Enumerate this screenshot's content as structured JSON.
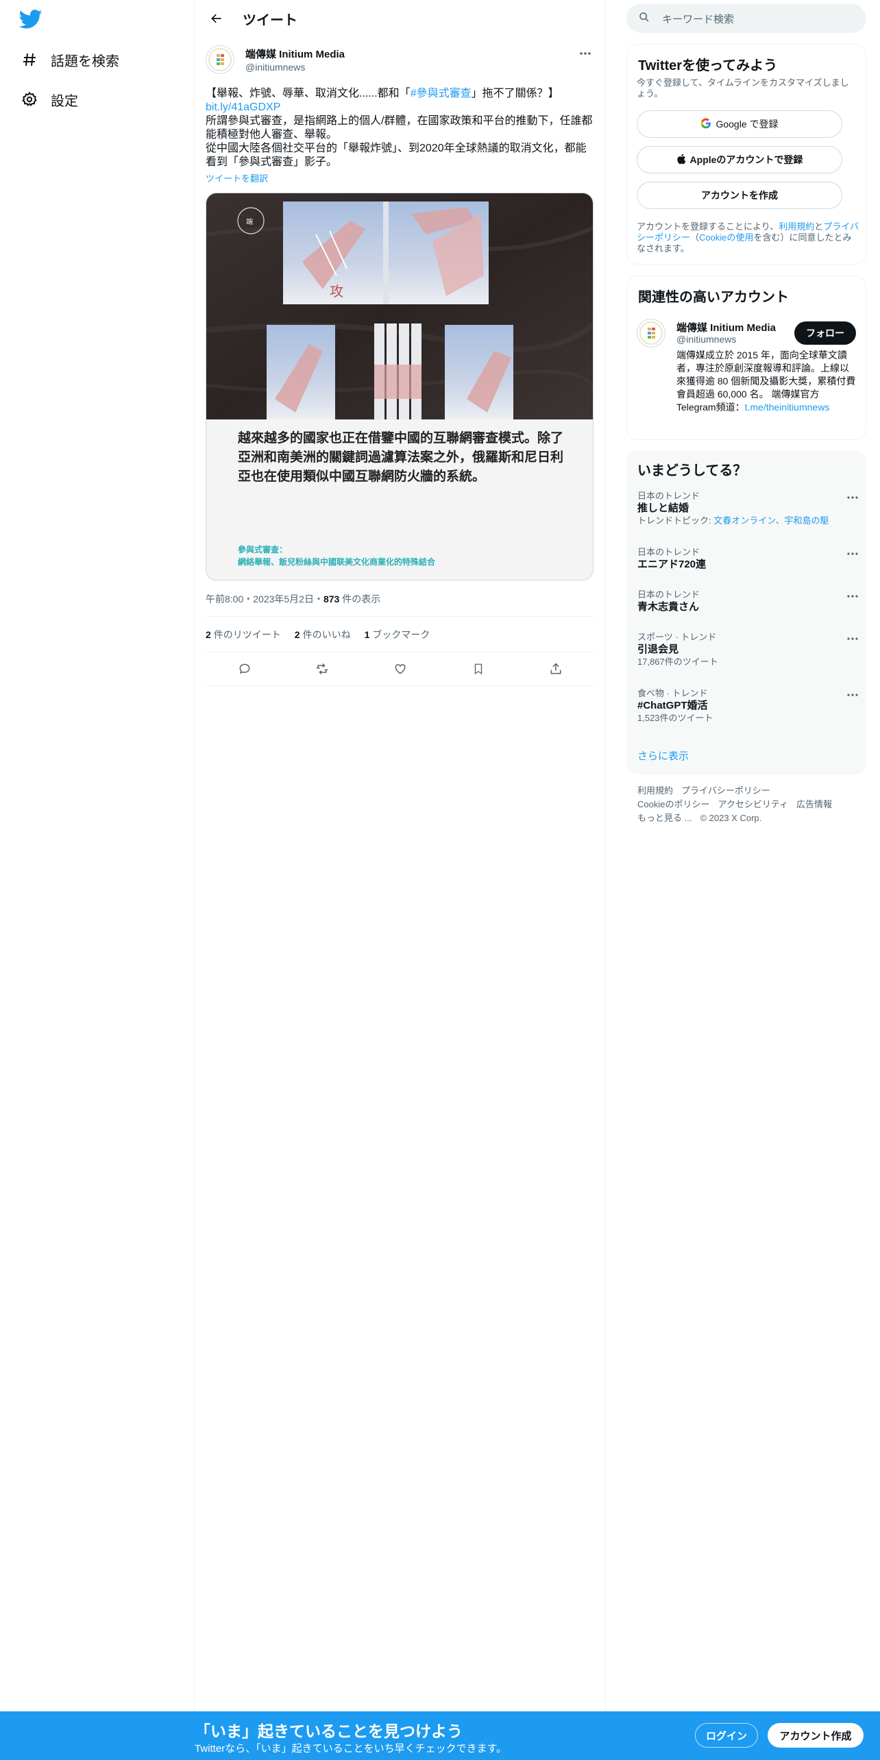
{
  "nav": {
    "explore_label": "話題を検索",
    "settings_label": "設定"
  },
  "header": {
    "title": "ツイート"
  },
  "tweet": {
    "author_name": "端傳媒 Initium Media",
    "author_handle": "@initiumnews",
    "text_part1": "【舉報、炸號、辱華、取消文化......都和「",
    "hashtag": "#參與式審查",
    "text_part2": "」拖不了關係？】",
    "link": "bit.ly/41aGDXP",
    "text_line2": "所謂參與式審查，是指網路上的個人/群體，在國家政策和平台的推動下，任誰都能積極對他人審查、舉報。",
    "text_line3": "從中國大陸各個社交平台的「舉報炸號」、到2020年全球熱議的取消文化，都能看到「參與式審查」影子。",
    "translate": "ツイートを翻訳",
    "card_text": "越來越多的國家也正在借鑒中國的互聯網審查模式。除了亞洲和南美洲的關鍵詞過濾算法案之外，俄羅斯和尼日利亞也在使用類似中國互聯網防火牆的系統。",
    "card_sub_title": "參與式審查：",
    "card_sub_desc": "網絡舉報、飯兒粉絲與中國联美文化商業化的特殊結合",
    "time": "午前8:00・2023年5月2日・",
    "views": "873",
    "views_label": " 件の表示",
    "retweets": "2",
    "retweets_label": "件のリツイート",
    "likes": "2",
    "likes_label": "件のいいね",
    "bookmarks": "1",
    "bookmarks_label": "ブックマーク"
  },
  "search": {
    "placeholder": "キーワード検索"
  },
  "signup_panel": {
    "title": "Twitterを使ってみよう",
    "subtitle": "今すぐ登録して、タイムラインをカスタマイズしましょう。",
    "google": "Google で登録",
    "apple": "Appleのアカウントで登録",
    "create": "アカウントを作成",
    "legal_1": "アカウントを登録することにより、",
    "legal_terms": "利用規約",
    "legal_2": "と",
    "legal_privacy": "プライバシーポリシー",
    "legal_3": "（",
    "legal_cookie": "Cookieの使用",
    "legal_4": "を含む）に同意したとみなされます。"
  },
  "related": {
    "title": "関連性の高いアカウント",
    "name": "端傳媒 Initium Media",
    "handle": "@initiumnews",
    "follow": "フォロー",
    "bio": "端傳媒成立於 2015 年，面向全球華文讀者，專注於原創深度報導和評論。上線以來獲得逾 80 個新聞及攝影大獎，累積付費會員超過 60,000 名。 端傳媒官方Telegram頻道：",
    "bio_link": "t.me/theinitiumnews"
  },
  "trends": {
    "title": "いまどうしてる？",
    "items": [
      {
        "category": "日本のトレンド",
        "name": "推しと結婚",
        "sub_prefix": "トレンドトピック: ",
        "sub_link": "文春オンライン、宇和島の駆"
      },
      {
        "category": "日本のトレンド",
        "name": "エニアド720連"
      },
      {
        "category": "日本のトレンド",
        "name": "青木志貴さん"
      },
      {
        "category": "スポーツ · トレンド",
        "name": "引退会見",
        "sub": "17,867件のツイート"
      },
      {
        "category": "食べ物 · トレンド",
        "name": "#ChatGPT婚活",
        "sub": "1,523件のツイート"
      }
    ],
    "show_more": "さらに表示"
  },
  "footer": {
    "terms": "利用規約",
    "privacy": "プライバシーポリシー",
    "cookie": "Cookieのポリシー",
    "accessibility": "アクセシビリティ",
    "ads": "広告情報",
    "more": "もっと見る ...",
    "copyright": "© 2023 X Corp."
  },
  "bottom_bar": {
    "title": "「いま」起きていることを見つけよう",
    "subtitle": "Twitterなら、「いま」起きていることをいち早くチェックできます。",
    "login": "ログイン",
    "signup": "アカウント作成"
  },
  "colors": {
    "accent": "#1d9bf0",
    "bottom_bar": "#1d9bf0",
    "text": "#0f1419",
    "muted": "#536471"
  }
}
